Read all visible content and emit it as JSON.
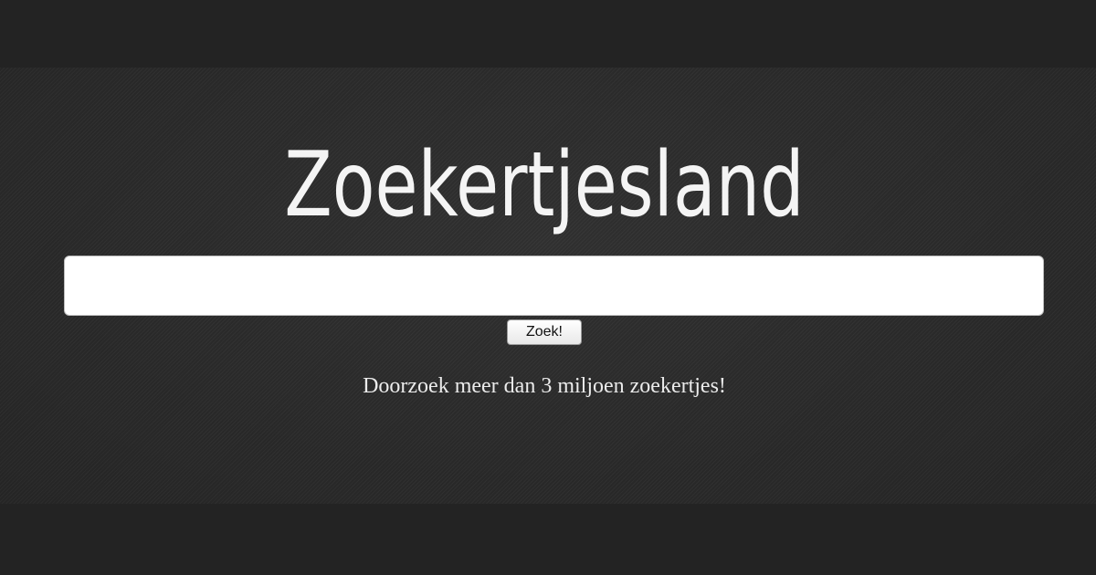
{
  "site": {
    "logo_text": "Zoekertjesland"
  },
  "search": {
    "value": "",
    "placeholder": "",
    "button_label": "Zoek!"
  },
  "tagline": "Doorzoek meer dan 3 miljoen zoekertjes!",
  "colors": {
    "page_bar": "#232323",
    "textured_bg": "#2c2c2c",
    "logo_text": "#f4f4f4",
    "input_bg": "#ffffff"
  }
}
